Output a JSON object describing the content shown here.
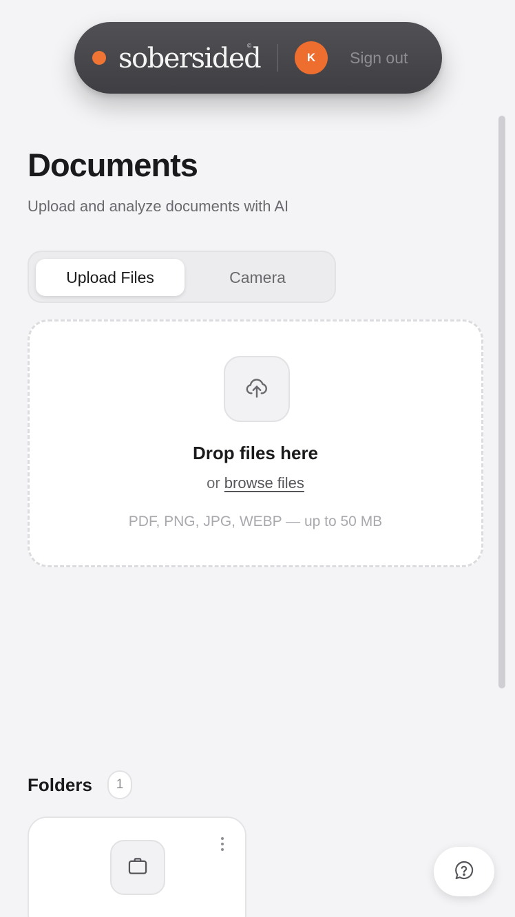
{
  "nav": {
    "brand": "sobersided",
    "brand_mark": "©",
    "avatar_initial": "K",
    "sign_out_label": "Sign out",
    "accent_color": "#f07535"
  },
  "header": {
    "title": "Documents",
    "subtitle": "Upload and analyze documents with AI"
  },
  "tabs": [
    {
      "label": "Upload Files",
      "active": true
    },
    {
      "label": "Camera",
      "active": false
    }
  ],
  "dropzone": {
    "icon": "cloud-upload-icon",
    "title": "Drop files here",
    "or_text": "or",
    "browse_label": "browse files",
    "formats": "PDF, PNG, JPG, WEBP — up to 50 MB"
  },
  "folders": {
    "title": "Folders",
    "count": "1",
    "items": [
      {
        "icon": "folder-briefcase-icon",
        "menu_icon": "more-vertical-icon"
      }
    ]
  },
  "help": {
    "icon": "help-chat-icon"
  }
}
